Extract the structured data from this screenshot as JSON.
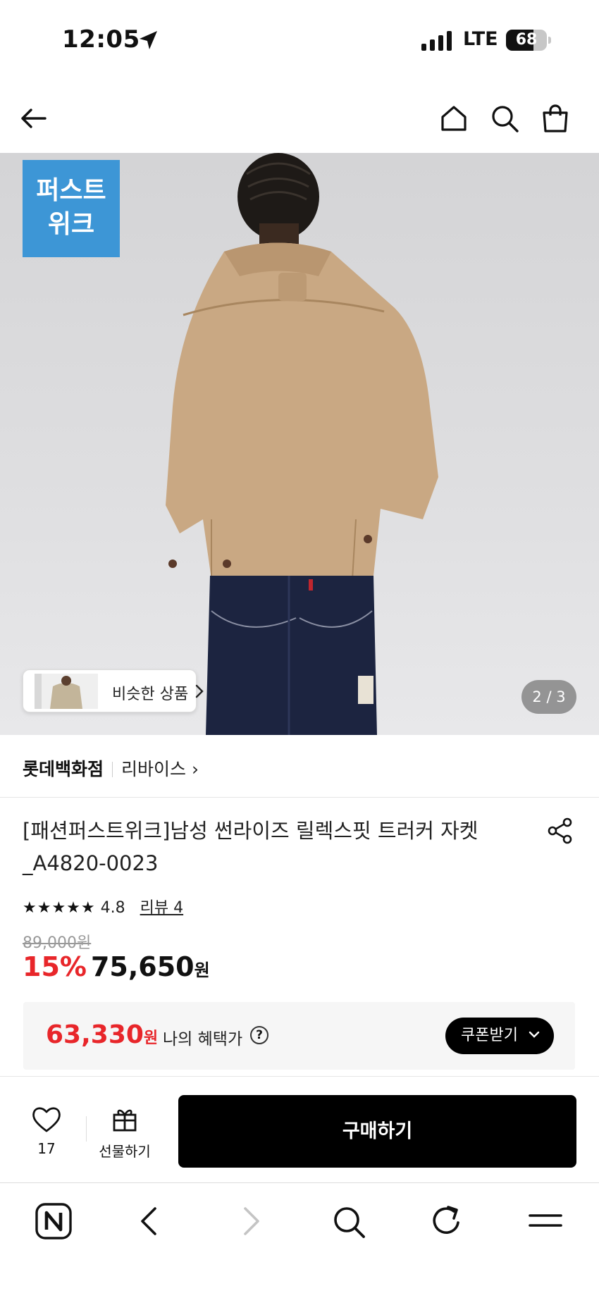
{
  "status_bar": {
    "time": "12:05",
    "network": "LTE",
    "battery": "68",
    "battery_level": 0.68
  },
  "header": {
    "icons": [
      "back-arrow-icon",
      "home-icon",
      "search-icon",
      "cart-icon"
    ]
  },
  "gallery": {
    "badge_line1": "퍼스트",
    "badge_line2": "위크",
    "similar_label": "비슷한 상품",
    "pager": "2 / 3"
  },
  "product": {
    "store": "롯데백화점",
    "brand": "리바이스 ›",
    "title_line1": "[패션퍼스트위크]남성 썬라이즈 릴렉스핏 트러커 자켓",
    "title_line2": "_A4820-0023",
    "stars": "★★★★★",
    "rating": "4.8",
    "review_label": "리뷰 4",
    "original_price": "89,000원",
    "discount": "15%",
    "sale_price": "75,650",
    "currency": "원",
    "colors": {
      "accent_red": "#e8262a",
      "badge_blue": "#3d96d6"
    }
  },
  "benefit": {
    "amount": "63,330",
    "currency": "원",
    "label": "나의 혜택가",
    "help": "?",
    "coupon_label": "쿠폰받기"
  },
  "actions": {
    "like_count": "17",
    "gift_label": "선물하기",
    "buy_label": "구매하기"
  },
  "browser_bar": {
    "icons": [
      "naver-n-icon",
      "browser-back-icon",
      "browser-forward-icon",
      "browser-search-icon",
      "reload-icon",
      "menu-icon"
    ]
  }
}
